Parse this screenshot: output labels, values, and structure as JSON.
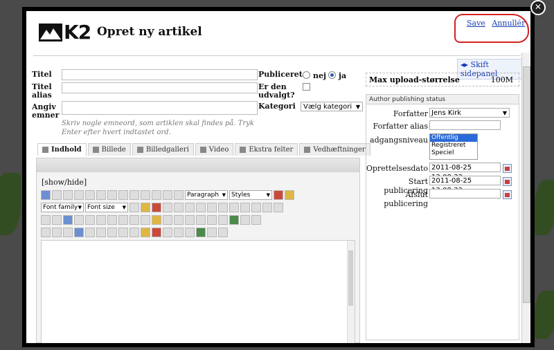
{
  "header": {
    "logo_text": "K2",
    "title": "Opret ny artikel",
    "save_label": "Save",
    "cancel_label": "Annullér"
  },
  "form": {
    "title_label": "Titel",
    "alias_label": "Titel alias",
    "tags_label": "Angiv emner",
    "tags_hint": "Skriv nogle emneord, som artiklen skal findes på. Tryk Enter efter hvert indtastet ord.",
    "published_label": "Publiceret",
    "published_no": "nej",
    "published_yes": "ja",
    "featured_label": "Er den udvalgt?",
    "category_label": "Kategori",
    "category_value": "Vælg kategori"
  },
  "tabs": [
    {
      "label": "Indhold"
    },
    {
      "label": "Billede"
    },
    {
      "label": "Billedgalleri"
    },
    {
      "label": "Video"
    },
    {
      "label": "Ekstra felter"
    },
    {
      "label": "Vedhæftninger"
    }
  ],
  "editor": {
    "show_hide": "[show/hide]",
    "format_select": "Paragraph",
    "styles_select": "Styles",
    "font_family": "Font family",
    "font_size": "Font size"
  },
  "sidepanel": {
    "toggle_label": "Skift sidepanel",
    "max_upload_label": "Max upload-størrelse",
    "max_upload_value": "100M",
    "status_title": "Author publishing status",
    "author_label": "Forfatter",
    "author_value": "Jens Kirk",
    "author_alias_label": "Forfatter alias",
    "access_label": "adgangsniveau",
    "access_options": [
      "Offentlig",
      "Registreret",
      "Speciel"
    ],
    "created_label": "Oprettelsesdato",
    "created_value": "2011-08-25 13:08:33",
    "publish_up_label": "Start publicering",
    "publish_up_value": "2011-08-25 13:08:33",
    "publish_down_label": "Afslut publicering",
    "publish_down_value": ""
  }
}
